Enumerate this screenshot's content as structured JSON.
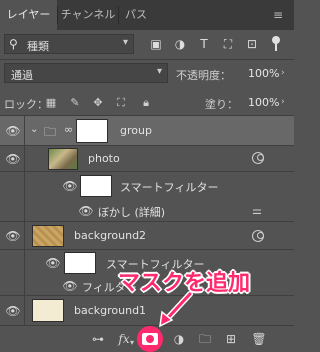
{
  "tabs": [
    {
      "label": "レイヤー",
      "active": true
    },
    {
      "label": "チャンネル",
      "active": false
    },
    {
      "label": "パス",
      "active": false
    }
  ],
  "filter": {
    "icon": "search-icon",
    "label": "種類"
  },
  "blend": {
    "mode": "通過",
    "opacity_label": "不透明度：",
    "opacity_value": "100%"
  },
  "lock": {
    "label": "ロック：",
    "fill_label": "塗り：",
    "fill_value": "100%"
  },
  "layers": [
    {
      "name": "group",
      "type": "group",
      "selected": true
    },
    {
      "name": "photo",
      "type": "smart-object"
    },
    {
      "name": "スマートフィルター",
      "type": "smart-filter-mask"
    },
    {
      "name": "ぼかし (詳細)",
      "type": "filter"
    },
    {
      "name": "background2",
      "type": "smart-object"
    },
    {
      "name": "スマートフィルター",
      "type": "smart-filter-mask"
    },
    {
      "name": "フィルター",
      "type": "filter"
    },
    {
      "name": "background1",
      "type": "layer"
    }
  ],
  "callout": {
    "text": "マスクを追加",
    "color": "#ff2a6d"
  },
  "accent": "#ff2a6d"
}
